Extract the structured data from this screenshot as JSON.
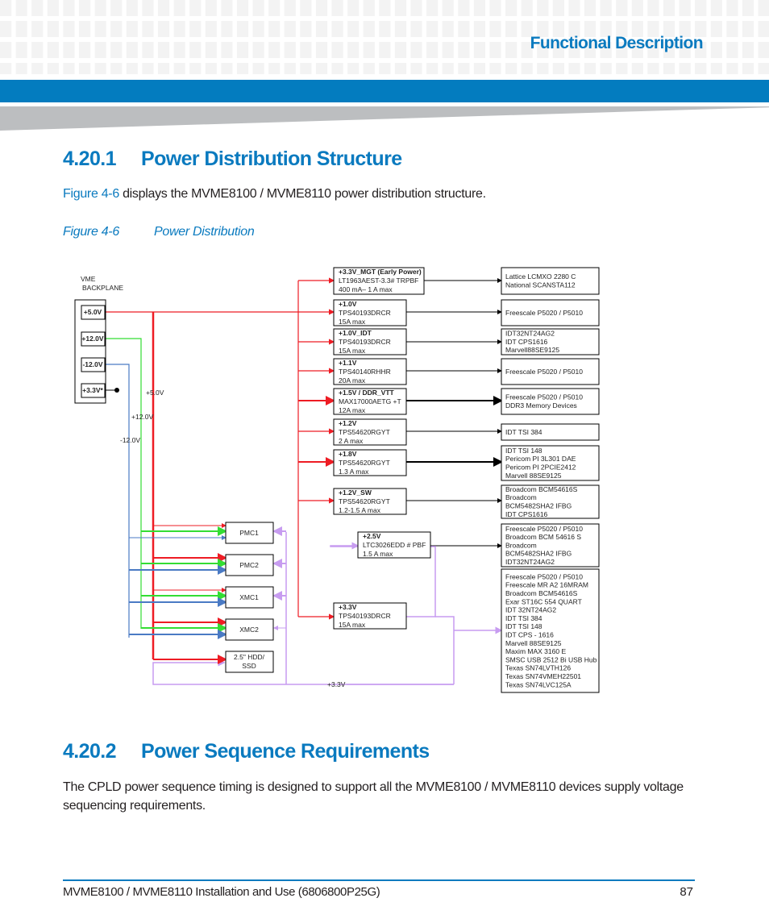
{
  "header": {
    "section_title": "Functional Description",
    "accent_color": "#0a7abf",
    "band_color": "#037cbf"
  },
  "section1": {
    "number": "4.20.1",
    "title": "Power Distribution Structure",
    "intro_link": "Figure 4-6",
    "intro_text": " displays the MVME8100 / MVME8110 power distribution structure.",
    "figure_number": "Figure 4-6",
    "figure_title": "Power Distribution"
  },
  "diagram": {
    "backplane_label_1": "VME",
    "backplane_label_2": "BACKPLANE",
    "backplane_rails": [
      "+5.0V",
      "+12.0V",
      "-12.0V",
      "+3.3V*"
    ],
    "rail_labels": {
      "p5": "+5.0V",
      "p12": "+12.0V",
      "m12": "-12.0V",
      "p33": "+3.3V"
    },
    "rail_colors": {
      "p5": "#ee1c24",
      "p12": "#33dd33",
      "m12": "#4a7ac4",
      "p33": "#c79cf0"
    },
    "regulators": [
      {
        "rail": "+3.3V_MGT (Early Power)",
        "part": "LT1963AEST-3.3# TRPBF",
        "current": "400 mA– 1 A max"
      },
      {
        "rail": "+1.0V",
        "part": "TPS40193DRCR",
        "current": "15A max"
      },
      {
        "rail": "+1.0V_IDT",
        "part": "TPS40193DRCR",
        "current": "15A max"
      },
      {
        "rail": "+1.1V",
        "part": "TPS40140RHHR",
        "current": "20A max"
      },
      {
        "rail": "+1.5V / DDR_VTT",
        "part": "MAX17000AETG +T",
        "current": "12A max"
      },
      {
        "rail": "+1.2V",
        "part": "TPS54620RGYT",
        "current": "2 A max"
      },
      {
        "rail": "+1.8V",
        "part": "TPS54620RGYT",
        "current": "1.3 A max"
      },
      {
        "rail": "+1.2V_SW",
        "part": "TPS54620RGYT",
        "current": "1.2-1.5 A max"
      },
      {
        "rail": "+2.5V",
        "part": "LTC3026EDD # PBF",
        "current": "1.5 A max"
      },
      {
        "rail": "+3.3V",
        "part": "TPS40193DRCR",
        "current": "15A max"
      }
    ],
    "loads": [
      {
        "lines": [
          "Lattice LCMXO 2280 C",
          "National SCANSTA112"
        ]
      },
      {
        "lines": [
          "Freescale P5020 / P5010"
        ]
      },
      {
        "lines": [
          "IDT32NT24AG2",
          "IDT CPS1616",
          "Marvell88SE9125"
        ]
      },
      {
        "lines": [
          "Freescale P5020 / P5010"
        ]
      },
      {
        "lines": [
          "Freescale P5020 / P5010",
          "DDR3  Memory Devices"
        ]
      },
      {
        "lines": [
          "IDT TSI 384"
        ]
      },
      {
        "lines": [
          "IDT TSI 148",
          "Pericom PI 3L301  DAE",
          "Pericom PI 2PCIE2412",
          "Marvell  88SE9125"
        ]
      },
      {
        "lines": [
          "Broadcom BCM54616S",
          "Broadcom",
          "BCM5482SHA2 IFBG",
          "IDT CPS1616"
        ]
      },
      {
        "lines": [
          "Freescale P5020 / P5010",
          "Broadcom BCM   54616 S",
          "Broadcom",
          "BCM5482SHA2 IFBG",
          "IDT32NT24AG2"
        ]
      },
      {
        "lines": [
          "Freescale P5020 / P5010",
          "Freescale MR A2   16MRAM",
          "Broadcom BCM54616S",
          "Exar ST16C 554 QUART",
          "IDT  32NT24AG2",
          "IDT TSI 384",
          "IDT TSI 148",
          "IDT CPS - 1616",
          "Marvell  88SE9125",
          "Maxim MAX  3160 E",
          "SMSC USB 2512 Bi USB Hub",
          "Texas SN74LVTH126",
          "Texas SN74VMEH22501",
          "Texas SN74LVC125A"
        ]
      }
    ],
    "modules": [
      "PMC1",
      "PMC2",
      "XMC1",
      "XMC2"
    ],
    "storage": {
      "line1": "2.5\" HDD/",
      "line2": "SSD"
    }
  },
  "section2": {
    "number": "4.20.2",
    "title": "Power Sequence Requirements",
    "body": "The CPLD power sequence timing is designed to support all the MVME8100 / MVME8110 devices supply voltage sequencing requirements."
  },
  "footer": {
    "document_title": "MVME8100 / MVME8110 Installation and Use (6806800P25G)",
    "page_number": "87"
  }
}
